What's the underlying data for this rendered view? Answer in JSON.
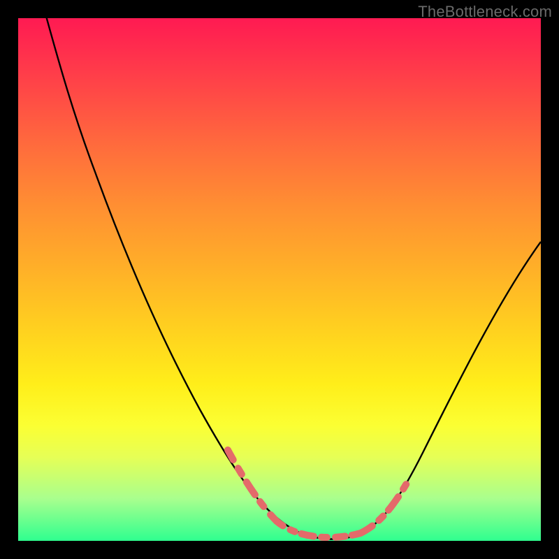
{
  "watermark": "TheBottleneck.com",
  "colors": {
    "frame": "#000000",
    "curve": "#000000",
    "dash": "#e46a6a",
    "gradient_top": "#ff1a52",
    "gradient_bottom": "#2fff8f"
  },
  "chart_data": {
    "type": "line",
    "title": "",
    "xlabel": "",
    "ylabel": "",
    "xlim": [
      0,
      100
    ],
    "ylim": [
      0,
      100
    ],
    "grid": false,
    "legend": false,
    "annotations": [
      "TheBottleneck.com"
    ],
    "series": [
      {
        "name": "bottleneck-curve",
        "x": [
          4,
          8,
          12,
          16,
          20,
          24,
          28,
          32,
          36,
          40,
          44,
          48,
          52,
          55,
          58,
          61,
          64,
          68,
          72,
          76,
          80,
          84,
          88,
          92,
          96,
          100
        ],
        "y": [
          100,
          94,
          87,
          80,
          73,
          66,
          58,
          50,
          42,
          34,
          26,
          18,
          10,
          5,
          2,
          1,
          1,
          3,
          8,
          15,
          22,
          29,
          36,
          43,
          50,
          57
        ]
      }
    ],
    "highlight": {
      "name": "near-zero-dash",
      "x": [
        44,
        48,
        52,
        55,
        58,
        61,
        64,
        68,
        72
      ],
      "y": [
        26,
        18,
        10,
        5,
        2,
        1,
        1,
        3,
        8
      ]
    }
  }
}
